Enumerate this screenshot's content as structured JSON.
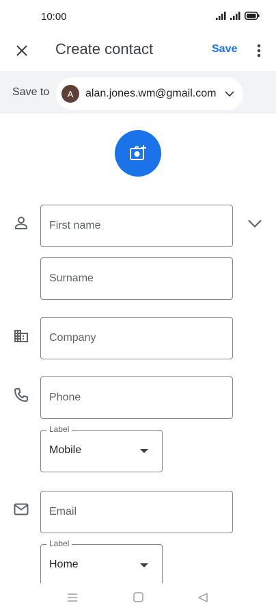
{
  "status_bar": {
    "time": "10:00"
  },
  "app_bar": {
    "title": "Create contact",
    "save_label": "Save"
  },
  "save_to": {
    "label": "Save to",
    "account_initial": "A",
    "account_email": "alan.jones.wm@gmail.com"
  },
  "fields": {
    "first_name": {
      "placeholder": "First name"
    },
    "surname": {
      "placeholder": "Surname"
    },
    "company": {
      "placeholder": "Company"
    },
    "phone": {
      "placeholder": "Phone"
    },
    "phone_label": {
      "legend": "Label",
      "value": "Mobile"
    },
    "email": {
      "placeholder": "Email"
    },
    "email_label": {
      "legend": "Label",
      "value": "Home"
    }
  },
  "colors": {
    "accent": "#1a73e8",
    "save_to_bg": "#f1f3f4",
    "avatar_bg": "#5d4037"
  },
  "icons": [
    "close-icon",
    "more-vert-icon",
    "chevron-down-icon",
    "add-photo-icon",
    "person-icon",
    "business-icon",
    "phone-icon",
    "email-icon",
    "nav-menu-icon",
    "nav-home-icon",
    "nav-back-icon"
  ]
}
